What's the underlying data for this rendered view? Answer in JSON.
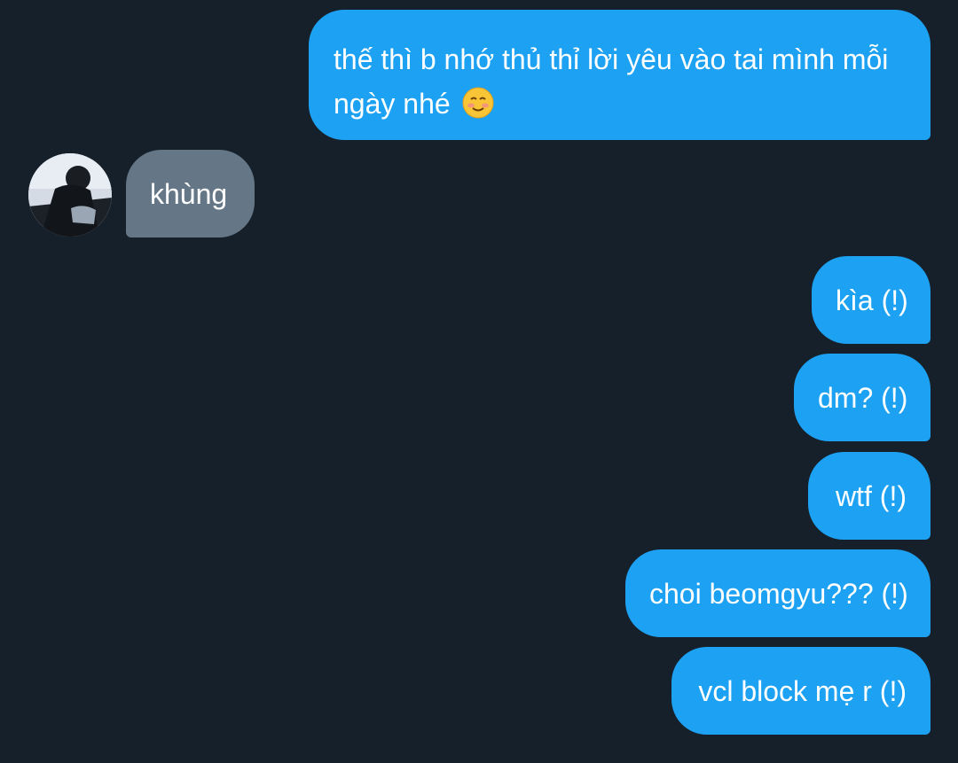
{
  "messages": {
    "m1_text": "thế thì b nhớ thủ thỉ lời yêu vào tai mình mỗi ngày nhé",
    "m1_emoji": "smiling-face-icon",
    "m2_text": "khùng",
    "m3_text": "kìa (!)",
    "m4_text": "dm? (!)",
    "m5_text": "wtf (!)",
    "m6_text": "choi beomgyu??? (!)",
    "m7_text": "vcl block mẹ r (!)"
  },
  "colors": {
    "background": "#16202b",
    "sent_bubble": "#1da1f2",
    "received_bubble": "#657786",
    "text": "#ffffff"
  }
}
